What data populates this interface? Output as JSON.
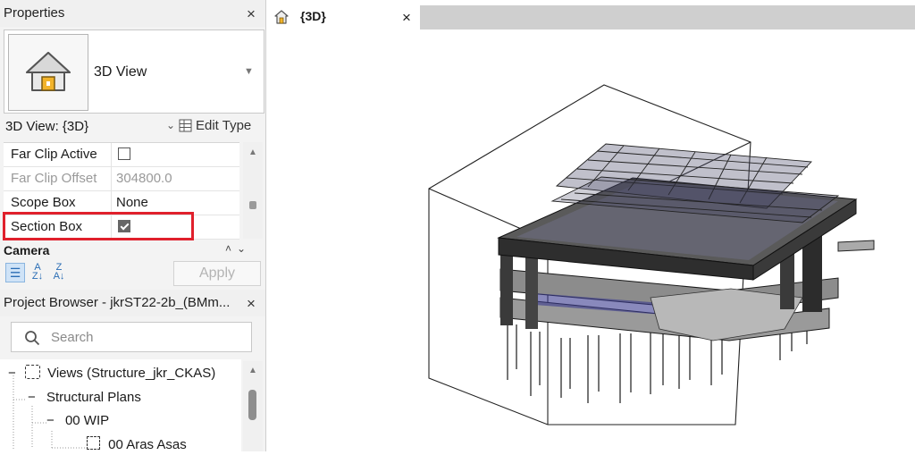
{
  "properties": {
    "title": "Properties",
    "close": "×",
    "type_name": "3D View",
    "instance_label": "3D View: {3D}",
    "edit_type": "Edit Type",
    "rows": [
      {
        "name": "Far Clip Active",
        "value": "",
        "checked": false,
        "disabled": false
      },
      {
        "name": "Far Clip Offset",
        "value": "304800.0",
        "disabled": true
      },
      {
        "name": "Scope Box",
        "value": "None",
        "disabled": false
      },
      {
        "name": "Section Box",
        "value": "",
        "checked": true,
        "disabled": false
      }
    ],
    "group_label": "Camera",
    "apply": "Apply",
    "highlight_color": "#e0202c"
  },
  "browser": {
    "title": "Project Browser - jkrST22-2b_(BMm...",
    "close": "×",
    "search_placeholder": "Search",
    "tree": [
      {
        "toggle": "−",
        "label": "Views (Structure_jkr_CKAS)"
      },
      {
        "toggle": "−",
        "label": "Structural Plans"
      },
      {
        "toggle": "−",
        "label": "00 WIP"
      },
      {
        "toggle": "",
        "label": "00 Aras Asas"
      }
    ]
  },
  "view_tab": {
    "title": "{3D}",
    "close": "×"
  },
  "icons": [
    "home-icon",
    "edit-type-icon",
    "search-icon",
    "close-icon",
    "chevron-down-icon",
    "sort-ascending-icon",
    "sort-descending-icon",
    "categorize-icon",
    "view-icon"
  ]
}
